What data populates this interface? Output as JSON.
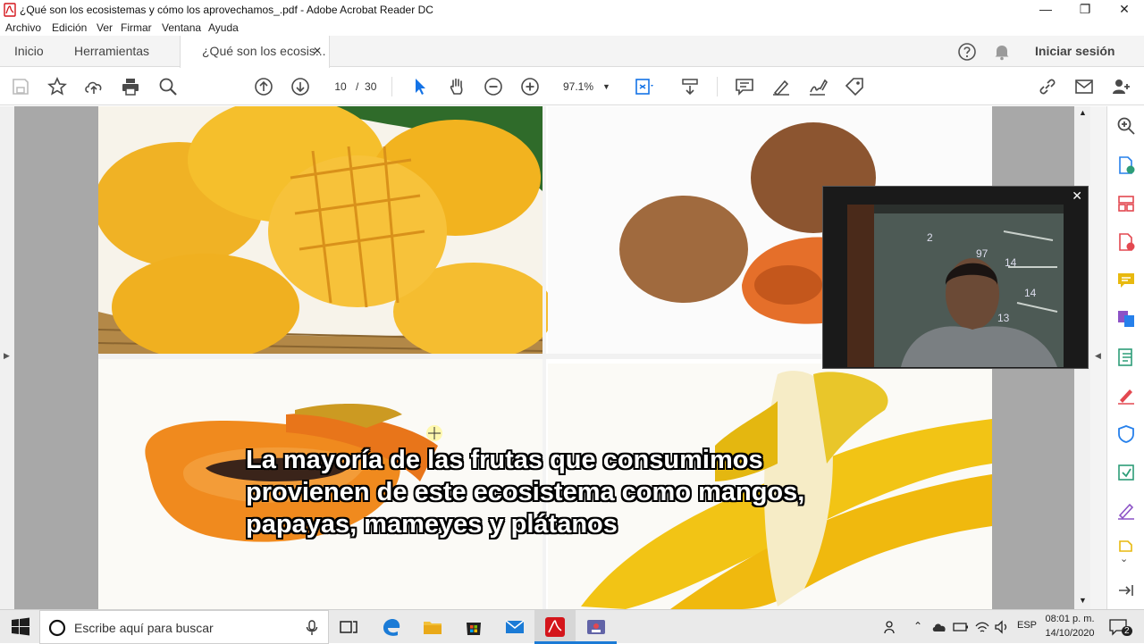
{
  "window": {
    "title": "¿Qué son los ecosistemas y cómo los aprovechamos_.pdf - Adobe Acrobat Reader DC",
    "minimize": "—",
    "restore": "❐",
    "close": "✕"
  },
  "menu": {
    "items": [
      "Archivo",
      "Edición",
      "Ver",
      "Firmar",
      "Ventana",
      "Ayuda"
    ]
  },
  "tabs": {
    "home": "Inicio",
    "tools": "Herramientas",
    "document": "¿Qué son los ecosis...",
    "document_close": "✕",
    "signin": "Iniciar sesión"
  },
  "toolbar": {
    "page_current": "10",
    "page_separator": "/",
    "page_total": "30",
    "zoom": "97.1%"
  },
  "document": {
    "caption_lines": [
      "La mayoría de las frutas que consumimos",
      "provienen de este ecosistema como mangos,",
      "papayas, mameyes y plátanos"
    ],
    "images": [
      "mangos",
      "mameyes",
      "papayas",
      "plátanos"
    ]
  },
  "video_overlay": {
    "close": "✕",
    "chalk_text": [
      "2",
      "97",
      "14",
      "14",
      "13"
    ]
  },
  "taskbar": {
    "search_placeholder": "Escribe aquí para buscar",
    "language": "ESP",
    "time": "08:01 p. m.",
    "date": "14/10/2020",
    "notification_count": "2"
  },
  "colors": {
    "acrobat_red": "#d4151b",
    "toolbar_icon": "#4a4a4a",
    "accent_blue": "#1473e6",
    "rp_red": "#e34850",
    "rp_green": "#2d9d78",
    "rp_yellow": "#e8b90f",
    "rp_purple": "#8c52c6",
    "rp_blue": "#2680eb"
  }
}
